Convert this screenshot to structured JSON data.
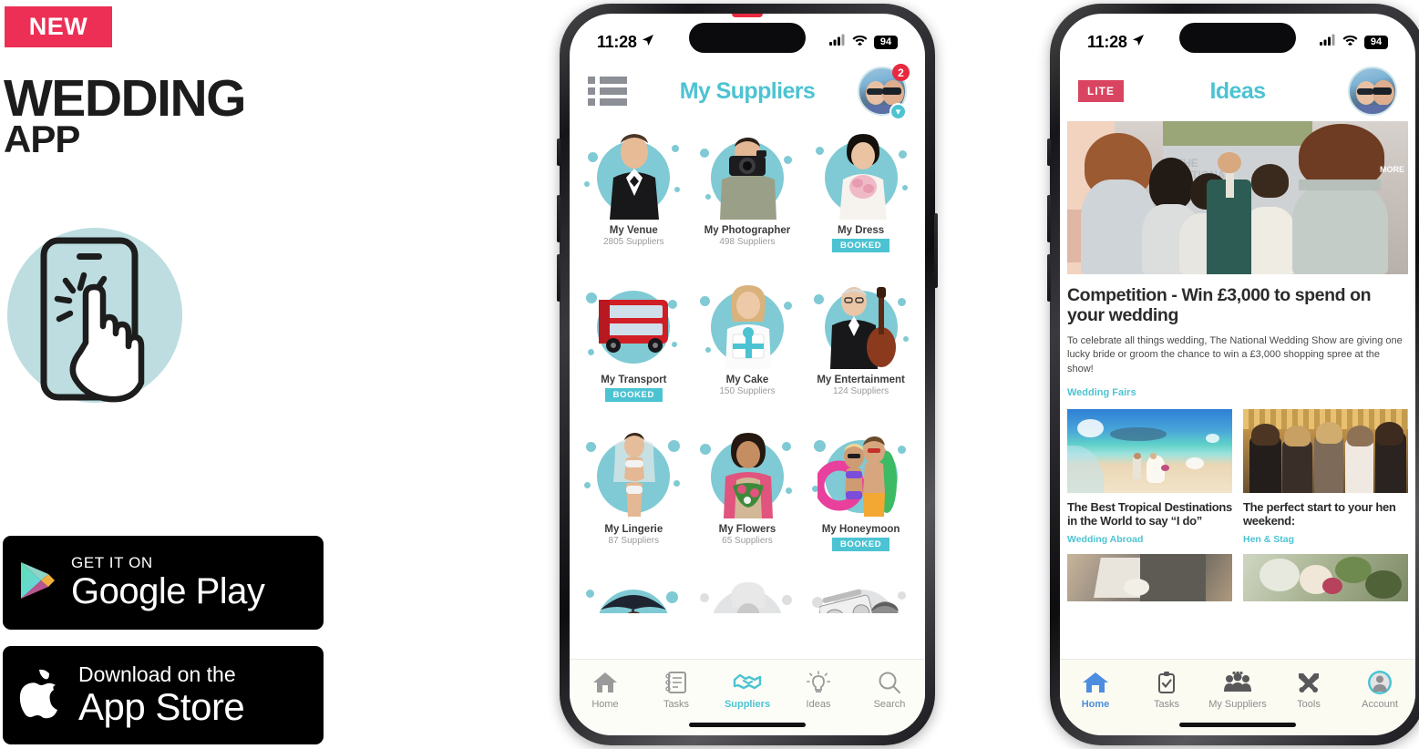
{
  "promo": {
    "badge": "NEW",
    "title_line1": "WEDDING",
    "title_line2": "APP",
    "tap_icon": "tap-phone-icon",
    "stores": [
      {
        "icon": "google-play-icon",
        "small": "GET IT ON",
        "big": "Google Play"
      },
      {
        "icon": "apple-logo-icon",
        "small": "Download on the",
        "big": "App Store"
      }
    ]
  },
  "colors": {
    "accent_teal": "#4CC3D2",
    "badge_red": "#ED2F55",
    "lite_pink": "#D94560",
    "booked_teal": "#4CC3D2",
    "nav_blue": "#4C8DE0",
    "circle_mint": "#BDDDE0"
  },
  "phone1": {
    "status": {
      "time": "11:28",
      "location_icon": "location-arrow-icon",
      "signal_icon": "cellular-signal-icon",
      "wifi_icon": "wifi-icon",
      "battery": "94"
    },
    "header": {
      "menu_icon": "list-view-icon",
      "title": "My Suppliers",
      "avatar_name": "user-avatar",
      "avatar_badge": "2",
      "avatar_chevron": "chevron-down-icon"
    },
    "suppliers": [
      {
        "name": "My Venue",
        "count": "2805 Suppliers",
        "booked": null,
        "art": "groom",
        "tone": "teal"
      },
      {
        "name": "My Photographer",
        "count": "498 Suppliers",
        "booked": null,
        "art": "photographer",
        "tone": "teal"
      },
      {
        "name": "My Dress",
        "count": null,
        "booked": "BOOKED",
        "art": "bride-dress",
        "tone": "teal"
      },
      {
        "name": "My Transport",
        "count": null,
        "booked": "BOOKED",
        "art": "red-bus",
        "tone": "teal"
      },
      {
        "name": "My Cake",
        "count": "150 Suppliers",
        "booked": null,
        "art": "cake-baker",
        "tone": "teal"
      },
      {
        "name": "My Entertainment",
        "count": "124 Suppliers",
        "booked": null,
        "art": "cellist",
        "tone": "teal"
      },
      {
        "name": "My Lingerie",
        "count": "87 Suppliers",
        "booked": null,
        "art": "lingerie-model",
        "tone": "teal"
      },
      {
        "name": "My Flowers",
        "count": "65 Suppliers",
        "booked": null,
        "art": "florist",
        "tone": "teal"
      },
      {
        "name": "My Honeymoon",
        "count": null,
        "booked": "BOOKED",
        "art": "honeymoon-couple",
        "tone": "teal"
      },
      {
        "name": "",
        "count": null,
        "booked": null,
        "art": "umbrella-man",
        "tone": "teal"
      },
      {
        "name": "",
        "count": null,
        "booked": null,
        "art": "chef",
        "tone": "grey"
      },
      {
        "name": "",
        "count": null,
        "booked": null,
        "art": "boombox-dj",
        "tone": "grey"
      }
    ],
    "tabs": [
      {
        "label": "Home",
        "icon": "home-icon",
        "active": false
      },
      {
        "label": "Tasks",
        "icon": "notepad-icon",
        "active": false
      },
      {
        "label": "Suppliers",
        "icon": "handshake-icon",
        "active": true
      },
      {
        "label": "Ideas",
        "icon": "lightbulb-icon",
        "active": false
      },
      {
        "label": "Search",
        "icon": "magnifier-icon",
        "active": false
      }
    ]
  },
  "phone2": {
    "status": {
      "time": "11:28",
      "location_icon": "location-arrow-icon",
      "signal_icon": "cellular-signal-icon",
      "wifi_icon": "wifi-icon",
      "battery": "94"
    },
    "header": {
      "lite_badge": "LITE",
      "title": "Ideas",
      "avatar_name": "user-avatar"
    },
    "hero": {
      "image_name": "national-wedding-show-runway-photo",
      "overlay_text": "MORE",
      "banner_line1": "THE",
      "banner_line2": "NATIONAL",
      "banner_line3": "WEDDING",
      "banner_line4": "SHOW"
    },
    "feature": {
      "title": "Competition - Win £3,000 to spend on your wedding",
      "body": "To celebrate all things wedding, The National Wedding Show are giving one lucky bride or groom the chance to win a £3,000 shopping spree at the show!",
      "tag": "Wedding Fairs"
    },
    "cards": [
      {
        "title": "The Best Tropical Destinations in the World to say “I do”",
        "tag": "Wedding Abroad",
        "image_name": "beach-wedding-couple-photo"
      },
      {
        "title": "The perfect start to your hen weekend:",
        "tag": "Hen & Stag",
        "image_name": "hen-party-group-photo"
      }
    ],
    "cards_next": [
      {
        "image_name": "groom-buttonhole-photo"
      },
      {
        "image_name": "bridal-bouquet-photo"
      }
    ],
    "tabs": [
      {
        "label": "Home",
        "icon": "home-icon",
        "active": true
      },
      {
        "label": "Tasks",
        "icon": "clipboard-check-icon",
        "active": false
      },
      {
        "label": "My Suppliers",
        "icon": "people-group-icon",
        "active": false
      },
      {
        "label": "Tools",
        "icon": "tools-icon",
        "active": false
      },
      {
        "label": "Account",
        "icon": "account-avatar-icon",
        "active": false
      }
    ]
  }
}
